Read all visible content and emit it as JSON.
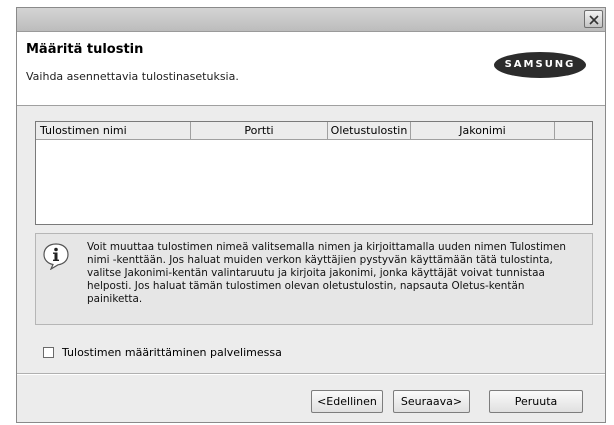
{
  "header": {
    "title": "Määritä tulostin",
    "subtitle": "Vaihda asennettavia tulostinasetuksia.",
    "logo_text": "SAMSUNG"
  },
  "table": {
    "columns": [
      "Tulostimen nimi",
      "Portti",
      "Oletustulostin",
      "Jakonimi",
      ""
    ],
    "rows": []
  },
  "info": {
    "icon": "info-icon",
    "text": "Voit muuttaa tulostimen nimeä valitsemalla nimen ja kirjoittamalla uuden nimen Tulostimen nimi -kenttään. Jos haluat muiden verkon käyttäjien pystyvän käyttämään tätä tulostinta, valitse Jakonimi-kentän valintaruutu ja kirjoita jakonimi, jonka käyttäjät voivat tunnistaa helposti. Jos haluat tämän tulostimen olevan oletustulostin, napsauta Oletus-kentän painiketta."
  },
  "checkbox": {
    "label": "Tulostimen määrittäminen palvelimessa",
    "checked": false
  },
  "buttons": {
    "back": "<Edellinen",
    "next": "Seuraava>",
    "cancel": "Peruuta"
  }
}
